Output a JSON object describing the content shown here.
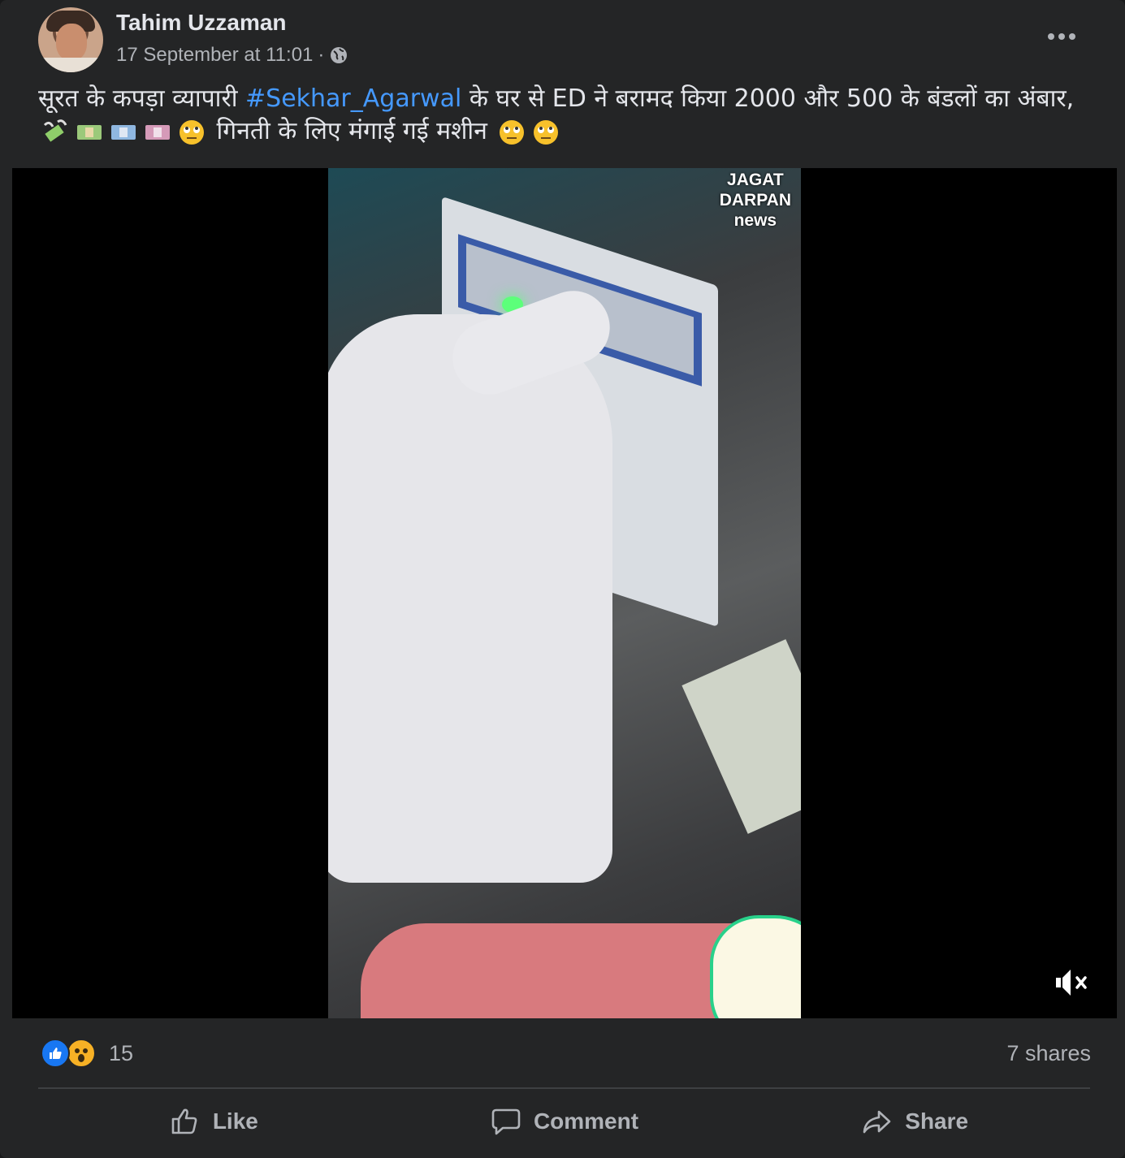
{
  "post": {
    "author": "Tahim Uzzaman",
    "timestamp": "17 September at 11:01",
    "separator": "·",
    "audience_icon": "globe-icon",
    "caption": {
      "text_before": "सूरत के कपड़ा व्यापारी ",
      "hashtag": "#Sekhar_Agarwal",
      "text_after": " के घर से ED ने बरामद किया 2000 और 500 के बंडलों का अंबार,",
      "line2_text": " गिनती के लिए मंगाई गई मशीन ",
      "emojis_line2_start": [
        "money-with-wings",
        "dollar-banknote",
        "euro-banknote",
        "pound-banknote",
        "face-with-rolling-eyes"
      ],
      "emojis_line2_end": [
        "face-with-rolling-eyes",
        "face-with-rolling-eyes"
      ]
    },
    "video": {
      "watermark": [
        "JAGAT",
        "DARPAN",
        "news"
      ],
      "muted": true,
      "mute_icon": "speaker-muted-icon"
    },
    "reactions": {
      "types": [
        "like",
        "wow"
      ],
      "count": "15"
    },
    "shares": "7 shares",
    "actions": {
      "like": "Like",
      "comment": "Comment",
      "share": "Share"
    }
  },
  "colors": {
    "card_bg": "#242526",
    "text_primary": "#e4e6eb",
    "text_secondary": "#b0b3b8",
    "hashtag": "#4599ff",
    "like_blue": "#1877f2",
    "wow_yellow": "#f7b125"
  }
}
